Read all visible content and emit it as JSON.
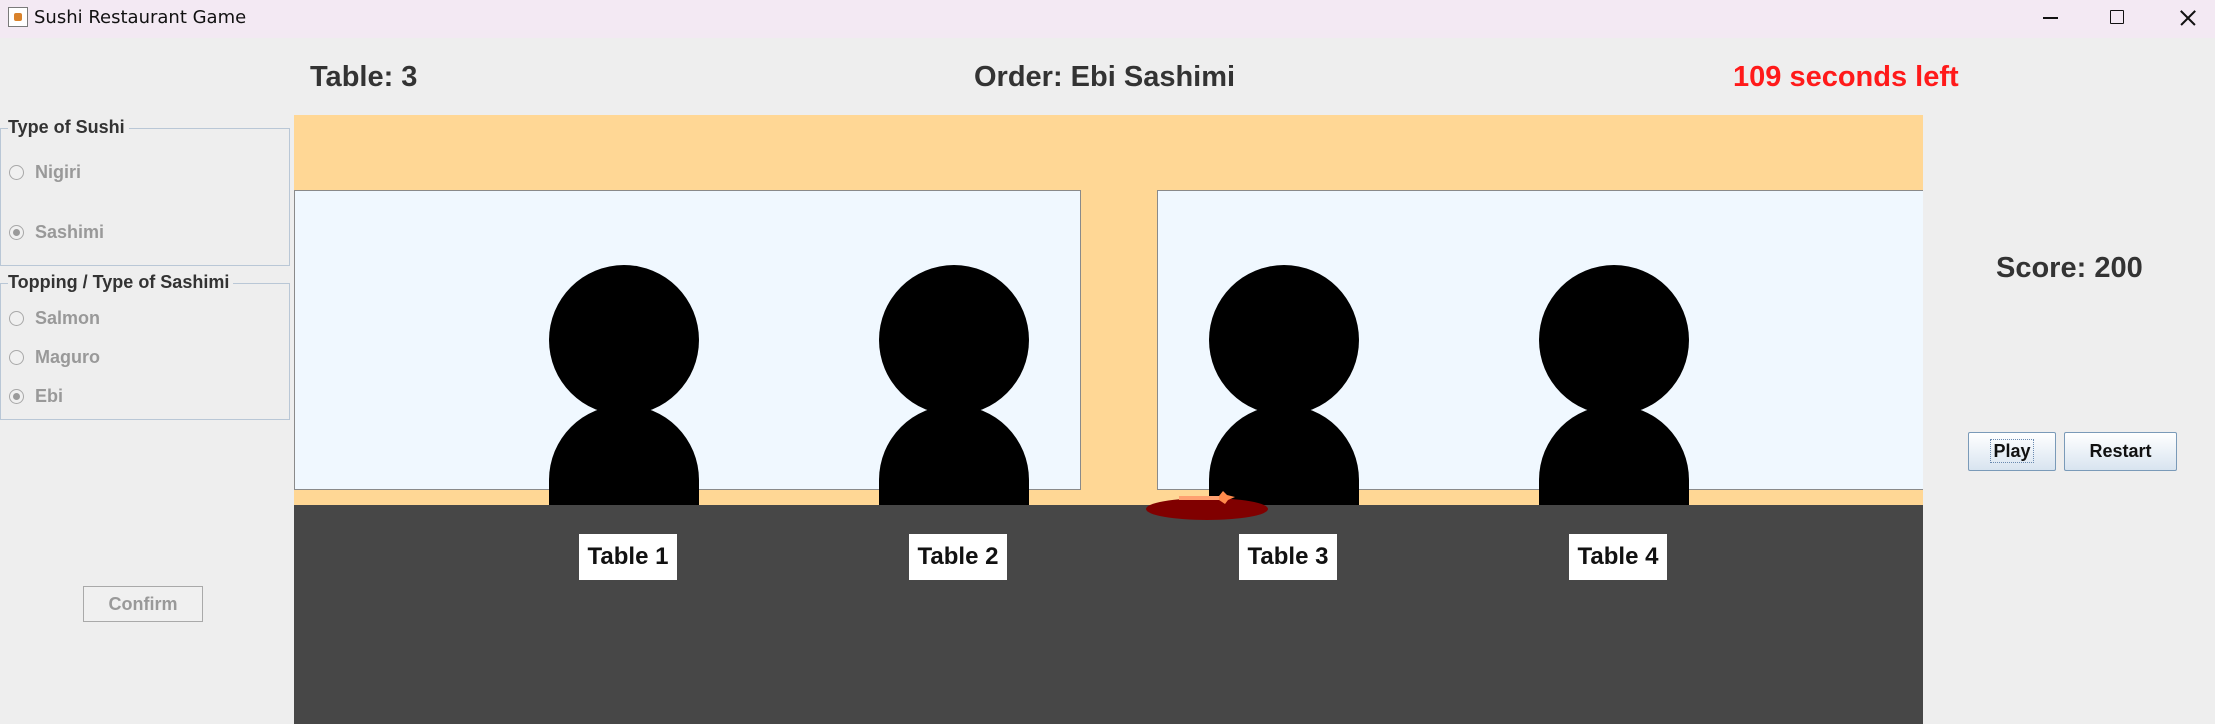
{
  "window": {
    "title": "Sushi Restaurant Game",
    "icon": "java-cup-icon",
    "controls": [
      "minimize-icon",
      "maximize-icon",
      "close-icon"
    ]
  },
  "header": {
    "table": "Table: 3",
    "order": "Order: Ebi Sashimi",
    "timer": "109 seconds left"
  },
  "sushi_type": {
    "title": "Type of Sushi",
    "options": [
      {
        "label": "Nigiri",
        "selected": false
      },
      {
        "label": "Sashimi",
        "selected": true
      }
    ]
  },
  "topping": {
    "title": "Topping / Type of Sashimi",
    "options": [
      {
        "label": "Salmon",
        "selected": false
      },
      {
        "label": "Maguro",
        "selected": false
      },
      {
        "label": "Ebi",
        "selected": true
      }
    ]
  },
  "confirm_label": "Confirm",
  "tables": [
    "Table 1",
    "Table 2",
    "Table 3",
    "Table 4"
  ],
  "score": "Score: 200",
  "buttons": {
    "play": "Play",
    "restart": "Restart"
  },
  "colors": {
    "timer": "#ff1a1a",
    "wall": "#ffd795",
    "window": "#f0f8ff",
    "counter": "#474747",
    "plate": "#800000",
    "customer": "#000000"
  }
}
